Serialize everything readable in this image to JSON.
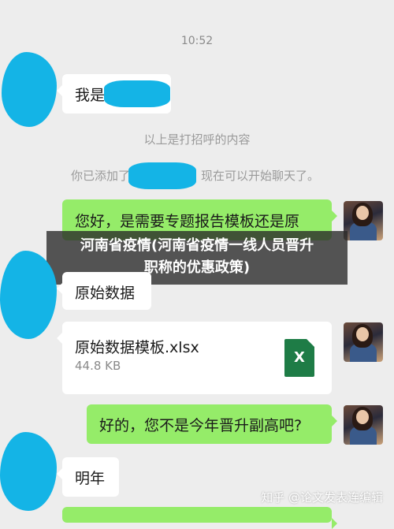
{
  "status": {
    "time": "10:52"
  },
  "system_messages": {
    "greeting_hint": "以上是打招呼的内容",
    "added_prefix": "你已添加了",
    "added_suffix": "现在可以开始聊天了。"
  },
  "messages": [
    {
      "side": "left",
      "text": "我是"
    },
    {
      "side": "right",
      "text": "您好，是需要专题报告模板还是原"
    },
    {
      "side": "left",
      "text": "原始数据"
    },
    {
      "side": "right_file",
      "file_name": "原始数据模板.xlsx",
      "file_size": "44.8 KB",
      "file_icon": "X"
    },
    {
      "side": "right",
      "text": "好的，您不是今年晋升副高吧?"
    },
    {
      "side": "left",
      "text": "明年"
    }
  ],
  "banner": {
    "line1": "河南省疫情(河南省疫情一线人员晋升",
    "line2": "职称的优惠政策)"
  },
  "watermark": "知乎 @论文发表连编辑",
  "colors": {
    "background": "#ededed",
    "sent_bubble": "#95ec69",
    "received_bubble": "#ffffff",
    "redaction": "#14b4e6",
    "excel": "#1e7c46"
  }
}
